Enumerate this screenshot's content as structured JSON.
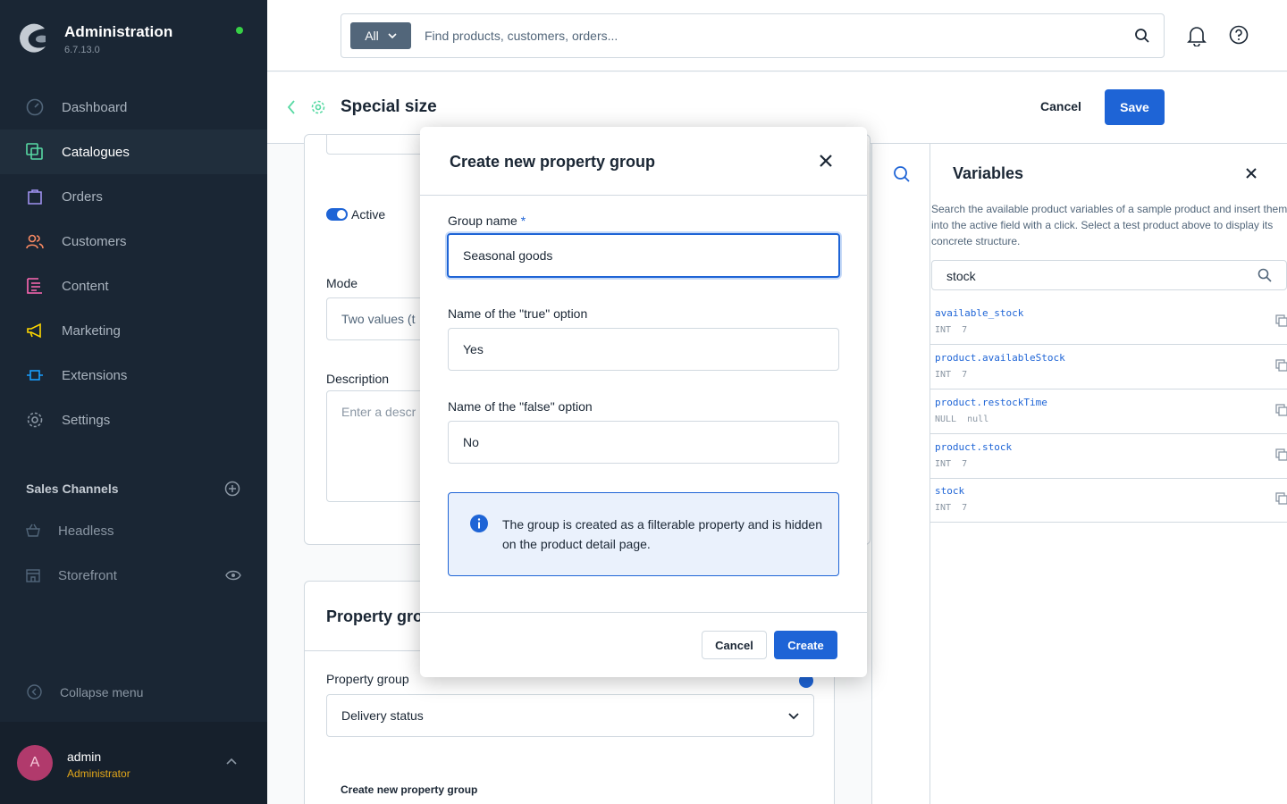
{
  "app": {
    "title": "Administration",
    "version": "6.7.13.0"
  },
  "sidebar": {
    "items": [
      {
        "label": "Dashboard",
        "icon": "dashboard-icon",
        "color": "#52667a"
      },
      {
        "label": "Catalogues",
        "icon": "catalogues-icon",
        "color": "#57d9a3"
      },
      {
        "label": "Orders",
        "icon": "orders-icon",
        "color": "#a092f0"
      },
      {
        "label": "Customers",
        "icon": "customers-icon",
        "color": "#f88962"
      },
      {
        "label": "Content",
        "icon": "content-icon",
        "color": "#ff68b4"
      },
      {
        "label": "Marketing",
        "icon": "marketing-icon",
        "color": "#ffd700"
      },
      {
        "label": "Extensions",
        "icon": "extensions-icon",
        "color": "#189eff"
      },
      {
        "label": "Settings",
        "icon": "settings-icon",
        "color": "#8a96a3"
      }
    ],
    "sales_channels_title": "Sales Channels",
    "sales_channels": [
      {
        "label": "Headless",
        "icon": "basket-icon"
      },
      {
        "label": "Storefront",
        "icon": "storefront-icon"
      }
    ],
    "collapse_label": "Collapse menu",
    "user": {
      "initial": "A",
      "name": "admin",
      "role": "Administrator"
    }
  },
  "topbar": {
    "search_scope": "All",
    "search_placeholder": "Find products, customers, orders..."
  },
  "page": {
    "title": "Special size",
    "cancel_label": "Cancel",
    "save_label": "Save"
  },
  "background_form": {
    "active_label": "Active",
    "mode_label": "Mode",
    "mode_value": "Two values (t",
    "description_label": "Description",
    "description_placeholder": "Enter a descr",
    "property_group_section": "Property gro",
    "property_group_label": "Property group",
    "property_group_value": "Delivery status",
    "create_link": "Create new property group"
  },
  "variables": {
    "title": "Variables",
    "description": "Search the available product variables of a sample product and insert them into the active field with a click. Select a test product above to display its concrete structure.",
    "search_value": "stock",
    "rows": [
      {
        "name": "available_stock",
        "type": "INT",
        "value": "7"
      },
      {
        "name": "product.availableStock",
        "type": "INT",
        "value": "7"
      },
      {
        "name": "product.restockTime",
        "type": "NULL",
        "value": "null"
      },
      {
        "name": "product.stock",
        "type": "INT",
        "value": "7"
      },
      {
        "name": "stock",
        "type": "INT",
        "value": "7"
      }
    ]
  },
  "modal": {
    "title": "Create new property group",
    "group_name_label": "Group name",
    "required_mark": "*",
    "group_name_value": "Seasonal goods",
    "true_label": "Name of the \"true\" option",
    "true_value": "Yes",
    "false_label": "Name of the \"false\" option",
    "false_value": "No",
    "info_text": "The group is created as a filterable property and is hidden on the product detail page.",
    "cancel_label": "Cancel",
    "create_label": "Create"
  },
  "colors": {
    "accent": "#1e64d6",
    "sidebar_bg": "#1a2634",
    "online": "#37d046"
  }
}
